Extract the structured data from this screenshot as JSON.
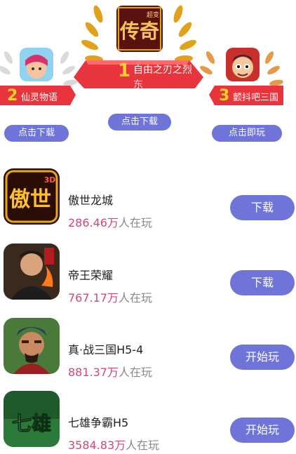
{
  "podium": {
    "first": {
      "rank": "1",
      "name": "自由之刃之烈",
      "name_overflow": "东",
      "button": "点击下载",
      "icon": "legend-game-icon",
      "icon_text": "传奇",
      "icon_badge": "超变"
    },
    "second": {
      "rank": "2",
      "name": "仙灵物语",
      "button": "点击下载",
      "icon": "fairy-game-icon"
    },
    "third": {
      "rank": "3",
      "name": "颤抖吧三国",
      "button": "点击即玩",
      "icon": "three-kingdoms-cartoon-icon"
    }
  },
  "games": [
    {
      "name": "傲世龙城",
      "count": "286.46万",
      "suffix": "人在玩",
      "button": "下载",
      "icon": "aoshi-dragon-city-icon",
      "icon_text": "傲世",
      "icon_badge": "3D"
    },
    {
      "name": "帝王荣耀",
      "count": "767.17万",
      "suffix": "人在玩",
      "button": "下载",
      "icon": "emperor-glory-icon"
    },
    {
      "name": "真·战三国H5-4",
      "count": "881.37万",
      "suffix": "人在玩",
      "button": "开始玩",
      "icon": "war-three-kingdoms-icon"
    },
    {
      "name": "七雄争霸H5",
      "count": "3584.83万",
      "suffix": "人在玩",
      "button": "开始玩",
      "icon": "seven-heroes-icon",
      "icon_text": "七雄"
    }
  ],
  "colors": {
    "accent": "#6f74d9",
    "ribbon": "#e8343d",
    "laurel": "#e0a21a",
    "count": "#d6457a"
  }
}
